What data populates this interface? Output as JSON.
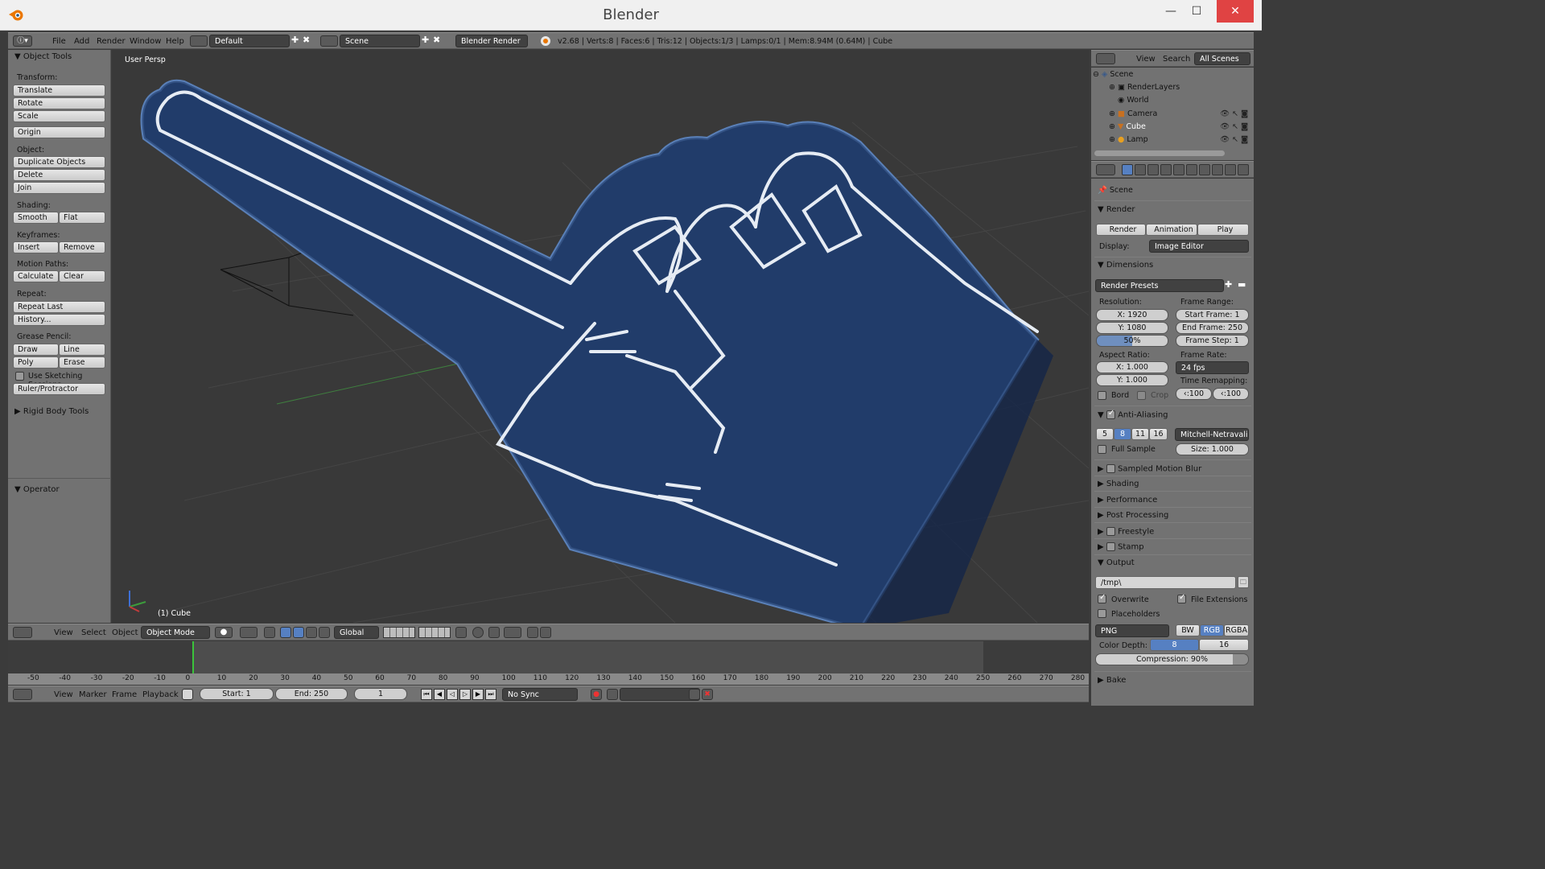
{
  "window": {
    "title": "Blender",
    "minimize": "—",
    "maximize": "☐",
    "close": "✕"
  },
  "info_header": {
    "menus": [
      "File",
      "Add",
      "Render",
      "Window",
      "Help"
    ],
    "layout": "Default",
    "scene": "Scene",
    "engine": "Blender Render",
    "stats": "v2.68 | Verts:8 | Faces:6 | Tris:12 | Objects:1/3 | Lamps:0/1 | Mem:8.94M (0.64M) | Cube"
  },
  "tool_shelf": {
    "title": "Object Tools",
    "transform_label": "Transform:",
    "translate": "Translate",
    "rotate": "Rotate",
    "scale": "Scale",
    "origin": "Origin",
    "object_label": "Object:",
    "duplicate": "Duplicate Objects",
    "delete": "Delete",
    "join": "Join",
    "shading_label": "Shading:",
    "smooth": "Smooth",
    "flat": "Flat",
    "keyframes_label": "Keyframes:",
    "insert": "Insert",
    "remove": "Remove",
    "motion_label": "Motion Paths:",
    "calculate": "Calculate",
    "clear": "Clear",
    "repeat_label": "Repeat:",
    "repeat_last": "Repeat Last",
    "history": "History...",
    "grease_label": "Grease Pencil:",
    "draw": "Draw",
    "line": "Line",
    "poly": "Poly",
    "erase": "Erase",
    "sketching": "Use Sketching Sessions",
    "ruler": "Ruler/Protractor",
    "rigid": "Rigid Body Tools",
    "operator": "Operator"
  },
  "viewport": {
    "view_name": "User Persp",
    "object_name": "(1) Cube"
  },
  "view3d_header": {
    "view": "View",
    "select": "Select",
    "object": "Object",
    "mode": "Object Mode",
    "orientation": "Global"
  },
  "timeline": {
    "ticks": [
      "-50",
      "-40",
      "-30",
      "-20",
      "-10",
      "0",
      "10",
      "20",
      "30",
      "40",
      "50",
      "60",
      "70",
      "80",
      "90",
      "100",
      "110",
      "120",
      "130",
      "140",
      "150",
      "160",
      "170",
      "180",
      "190",
      "200",
      "210",
      "220",
      "230",
      "240",
      "250",
      "260",
      "270",
      "280"
    ],
    "view": "View",
    "marker": "Marker",
    "frame": "Frame",
    "playback": "Playback",
    "start": "Start: 1",
    "end": "End: 250",
    "current": "1",
    "sync": "No Sync"
  },
  "outliner": {
    "view": "View",
    "search": "Search",
    "filter": "All Scenes",
    "items": [
      "Scene",
      "RenderLayers",
      "World",
      "Camera",
      "Cube",
      "Lamp"
    ]
  },
  "properties": {
    "context": "Scene",
    "render_panel": "Render",
    "render_btn": "Render",
    "animation_btn": "Animation",
    "play_btn": "Play",
    "display_label": "Display:",
    "display_value": "Image Editor",
    "dimensions": "Dimensions",
    "presets": "Render Presets",
    "resolution_label": "Resolution:",
    "res_x": "X: 1920",
    "res_y": "Y: 1080",
    "res_pct": "50%",
    "frame_range_label": "Frame Range:",
    "start_frame": "Start Frame: 1",
    "end_frame": "End Frame: 250",
    "frame_step": "Frame Step: 1",
    "aspect_label": "Aspect Ratio:",
    "aspect_x": "X: 1.000",
    "aspect_y": "Y: 1.000",
    "frame_rate_label": "Frame Rate:",
    "frame_rate": "24 fps",
    "time_remap_label": "Time Remapping:",
    "remap_old": "100",
    "remap_new": "100",
    "bord": "Bord",
    "crop": "Crop",
    "aa": "Anti-Aliasing",
    "aa_samples": [
      "5",
      "8",
      "11",
      "16"
    ],
    "aa_filter": "Mitchell-Netravali",
    "full_sample": "Full Sample",
    "aa_size": "Size: 1.000",
    "motion_blur": "Sampled Motion Blur",
    "shading": "Shading",
    "performance": "Performance",
    "post": "Post Processing",
    "freestyle": "Freestyle",
    "stamp": "Stamp",
    "output": "Output",
    "path": "/tmp\\",
    "overwrite": "Overwrite",
    "file_ext": "File Extensions",
    "placeholders": "Placeholders",
    "format": "PNG",
    "bw": "BW",
    "rgb": "RGB",
    "rgba": "RGBA",
    "color_depth_label": "Color Depth:",
    "depth_8": "8",
    "depth_16": "16",
    "compression": "Compression: 90%",
    "bake": "Bake"
  }
}
